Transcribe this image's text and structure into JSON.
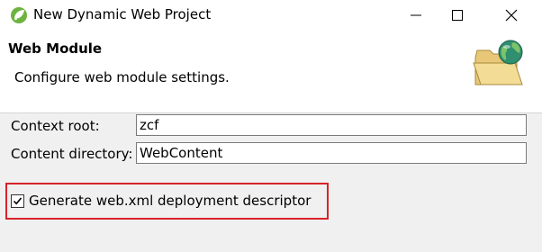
{
  "window": {
    "title": "New Dynamic Web Project",
    "icons": {
      "app": "eclipse-spring-icon",
      "minimize": "minimize-icon",
      "maximize": "maximize-icon",
      "close": "close-icon"
    }
  },
  "banner": {
    "title": "Web Module",
    "description": "Configure web module settings.",
    "icon": "web-module-folder-globe-icon"
  },
  "form": {
    "context_root": {
      "label": "Context root:",
      "value": "zcf"
    },
    "content_directory": {
      "label": "Content directory:",
      "value": "WebContent"
    },
    "generate_descriptor": {
      "label": "Generate web.xml deployment descriptor",
      "checked": true
    }
  },
  "colors": {
    "highlight_border": "#d9232a",
    "banner_bg": "#ffffff",
    "body_bg": "#f0f0f0"
  }
}
